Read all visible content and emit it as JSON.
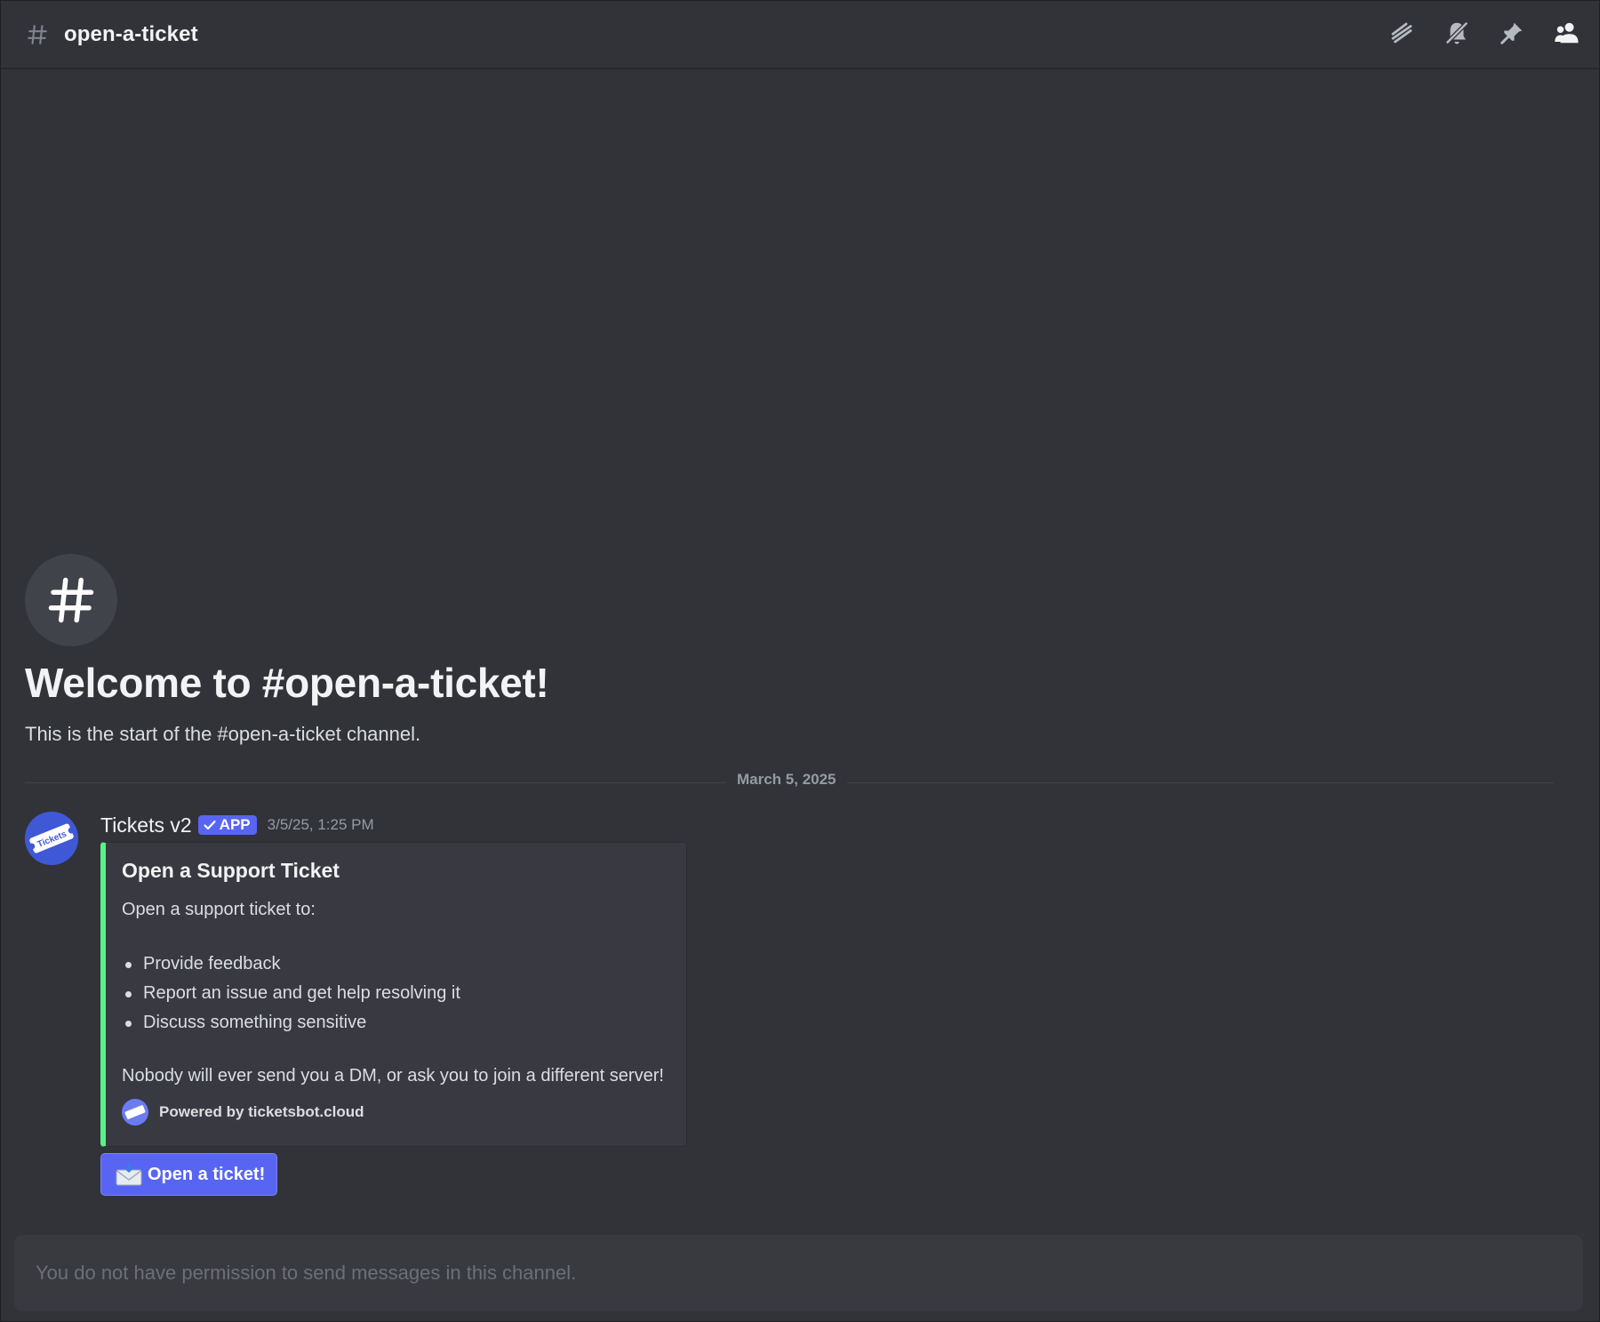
{
  "header": {
    "channel_name": "open-a-ticket",
    "tools": [
      {
        "icon": "threads-icon"
      },
      {
        "icon": "bell-muted-icon"
      },
      {
        "icon": "pin-icon"
      },
      {
        "icon": "members-icon"
      }
    ]
  },
  "intro": {
    "title": "Welcome to #open-a-ticket!",
    "subtitle": "This is the start of the #open-a-ticket channel."
  },
  "divider": {
    "date": "March 5, 2025"
  },
  "message": {
    "username": "Tickets v2",
    "badge": "APP",
    "timestamp": "3/5/25, 1:25 PM",
    "avatar_label": "Tickets",
    "embed": {
      "accent_color": "#57f287",
      "title": "Open a Support Ticket",
      "description": "Open a support ticket to:",
      "items": [
        "Provide feedback",
        "Report an issue and get help resolving it",
        "Discuss something sensitive"
      ],
      "note": "Nobody will ever send you a DM, or ask you to join a different server!",
      "footer": "Powered by ticketsbot.cloud"
    },
    "button": {
      "emoji": "incoming-envelope-icon",
      "label": "Open a ticket!"
    }
  },
  "input": {
    "placeholder": "You do not have permission to send messages in this channel."
  },
  "colors": {
    "background": "#313338",
    "blurple": "#5865f2",
    "embed_bg": "#393a41"
  }
}
